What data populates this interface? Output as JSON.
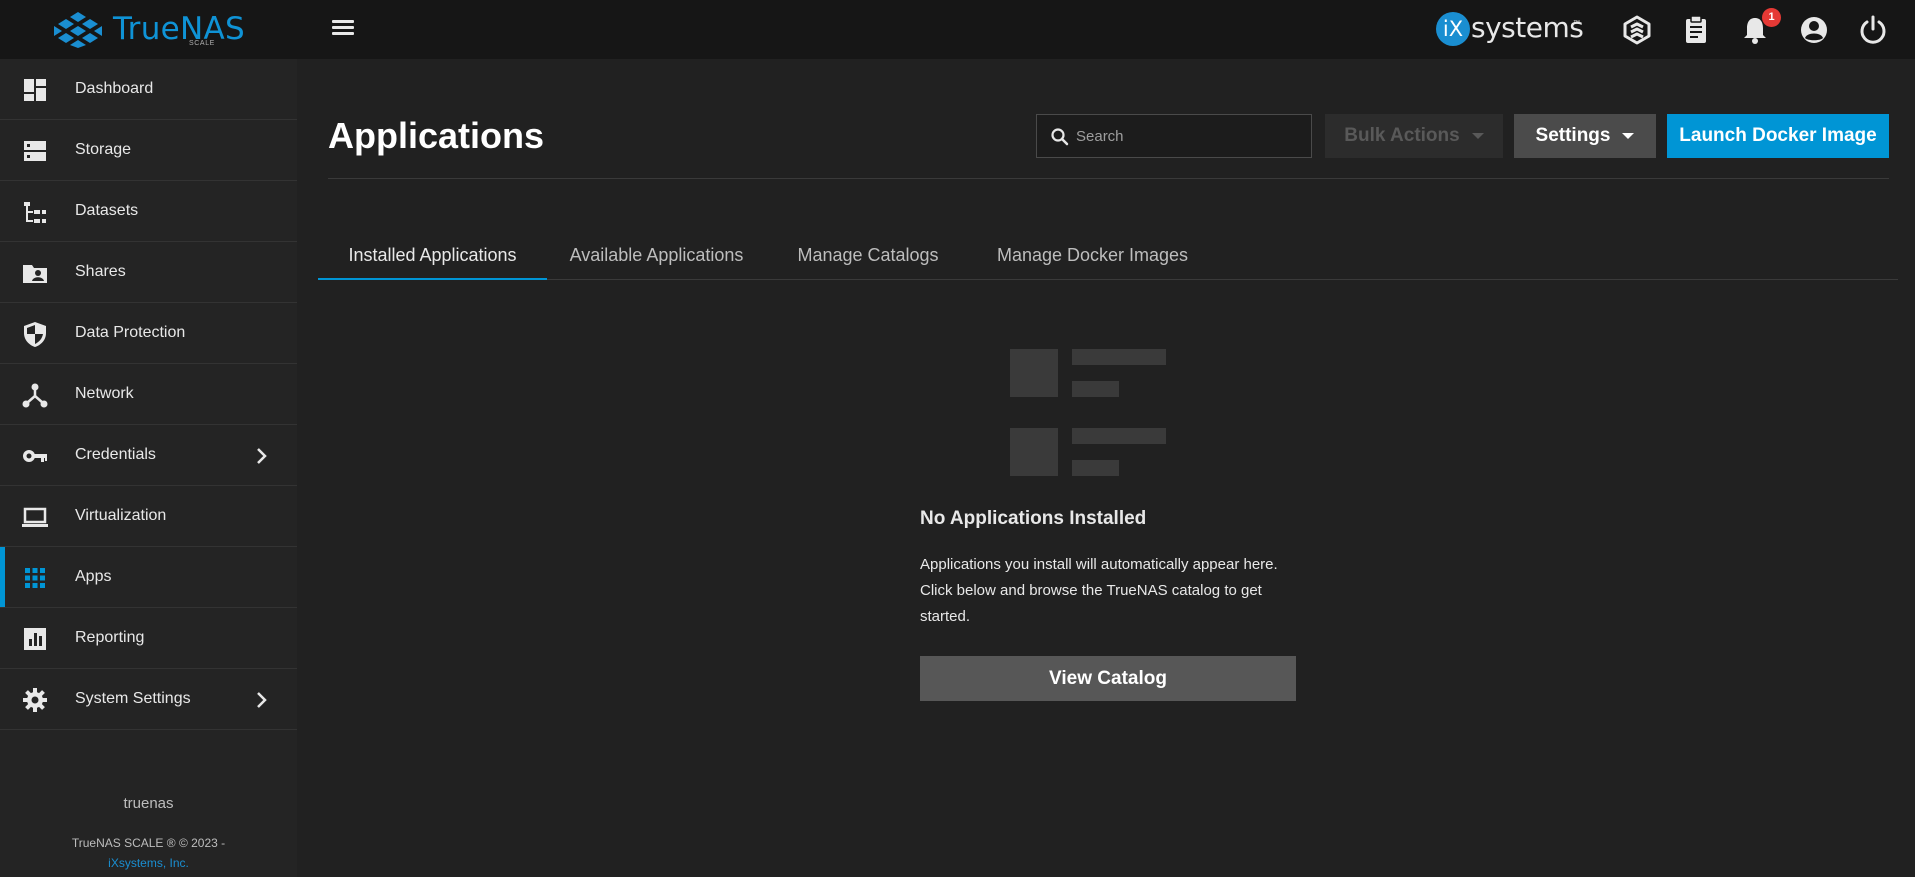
{
  "brand": {
    "product_name": "TrueNAS",
    "edition_label": "SCALE",
    "vendor_badge": "iX",
    "vendor_text": "systems",
    "vendor_tm": "™"
  },
  "topbar": {
    "icons": [
      "menu-icon",
      "truecommand-icon",
      "jobs-clipboard-icon",
      "notifications-bell-icon",
      "account-icon",
      "power-icon"
    ],
    "notification_count": "1"
  },
  "sidebar": {
    "items": [
      {
        "label": "Dashboard",
        "icon": "dashboard-icon"
      },
      {
        "label": "Storage",
        "icon": "storage-icon"
      },
      {
        "label": "Datasets",
        "icon": "datasets-icon"
      },
      {
        "label": "Shares",
        "icon": "shares-icon"
      },
      {
        "label": "Data Protection",
        "icon": "shield-icon"
      },
      {
        "label": "Network",
        "icon": "network-icon"
      },
      {
        "label": "Credentials",
        "icon": "key-icon"
      },
      {
        "label": "Virtualization",
        "icon": "laptop-icon"
      },
      {
        "label": "Apps",
        "icon": "apps-grid-icon"
      },
      {
        "label": "Reporting",
        "icon": "reporting-icon"
      },
      {
        "label": "System Settings",
        "icon": "gear-icon"
      }
    ],
    "active_item": "Apps",
    "hostname": "truenas",
    "copyright": "TrueNAS SCALE ® © 2023 -",
    "company_link": "iXsystems, Inc."
  },
  "main": {
    "title": "Applications",
    "search_placeholder": "Search",
    "bulk_actions_label": "Bulk Actions",
    "settings_label": "Settings",
    "launch_label": "Launch Docker Image",
    "tabs": [
      {
        "label": "Installed Applications",
        "active": true
      },
      {
        "label": "Available Applications",
        "active": false
      },
      {
        "label": "Manage Catalogs",
        "active": false
      },
      {
        "label": "Manage Docker Images",
        "active": false
      }
    ],
    "empty_state": {
      "title": "No Applications Installed",
      "message": "Applications you install will automatically appear here. Click below and browse the TrueNAS catalog to get started.",
      "button_label": "View Catalog"
    }
  },
  "colors": {
    "accent": "#0095d5",
    "topbar_bg": "#161616",
    "sidebar_bg": "#242424",
    "main_bg": "#212121",
    "badge": "#e53935"
  }
}
